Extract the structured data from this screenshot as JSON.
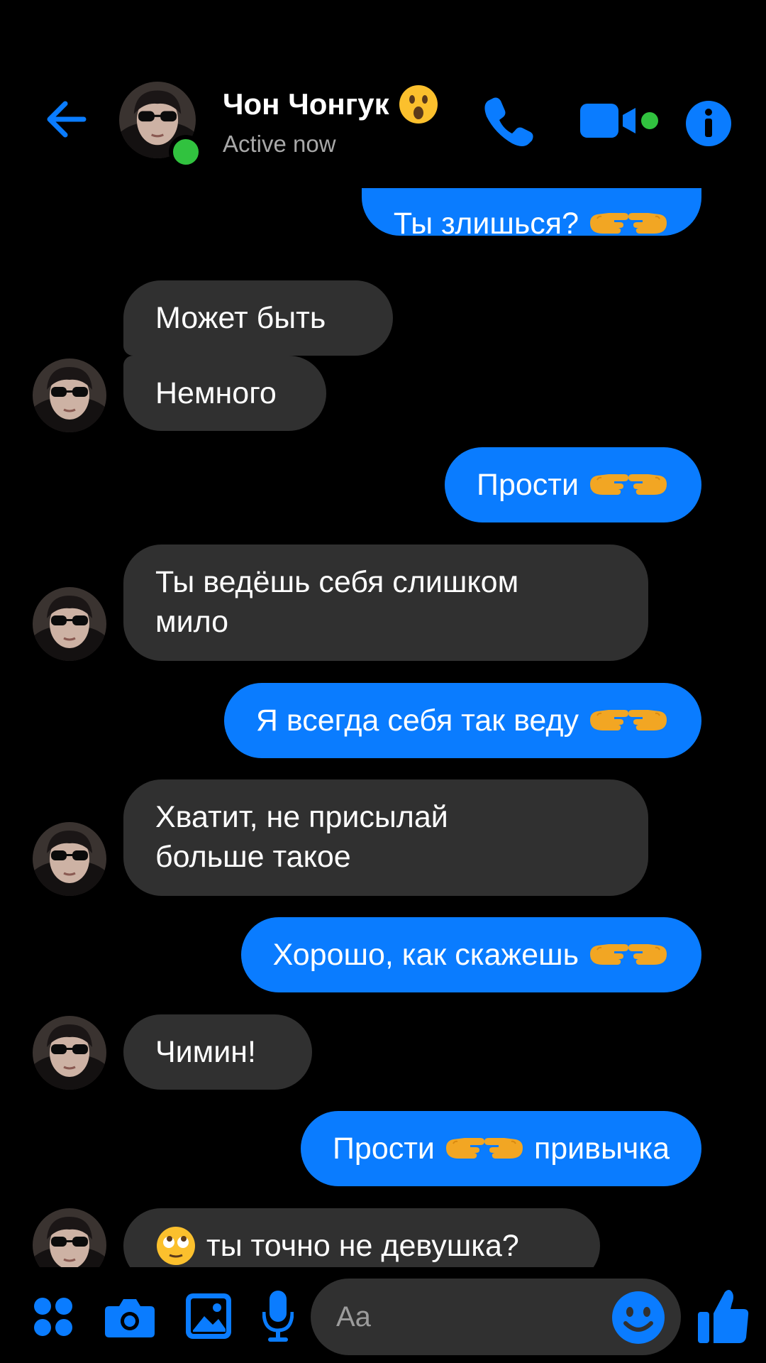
{
  "header": {
    "contact_name": "Чон Чонгук",
    "status": "Active now",
    "accent_color": "#0a7cff",
    "online_color": "#31c23f",
    "name_emoji_icon": "astonished-face-icon"
  },
  "messages": [
    {
      "direction": "outgoing",
      "text": "Ты злишься?",
      "emoji_icon": "pointing-fingers-icon"
    },
    {
      "direction": "incoming",
      "text": "Может быть"
    },
    {
      "direction": "incoming",
      "text": "Немного",
      "avatar": true
    },
    {
      "direction": "outgoing",
      "text": "Прости",
      "emoji_icon": "pointing-fingers-icon"
    },
    {
      "direction": "incoming",
      "text": "Ты ведёшь себя слишком мило",
      "avatar": true
    },
    {
      "direction": "outgoing",
      "text": "Я всегда себя так веду",
      "emoji_icon": "pointing-fingers-icon"
    },
    {
      "direction": "incoming",
      "text": "Хватит, не присылай больше такое",
      "avatar": true
    },
    {
      "direction": "outgoing",
      "text": "Хорошо, как скажешь",
      "emoji_icon": "pointing-fingers-icon"
    },
    {
      "direction": "incoming",
      "text": "Чимин!",
      "avatar": true
    },
    {
      "direction": "outgoing",
      "text_before": "Прости",
      "text_after": "привычка",
      "emoji_icon": "pointing-fingers-icon"
    },
    {
      "direction": "incoming",
      "text": "ты точно не девушка?",
      "emoji_icon": "rolling-eyes-face-icon",
      "avatar": true
    }
  ],
  "composer": {
    "placeholder": "Aa",
    "icons": [
      "four-dots-menu-icon",
      "camera-icon",
      "gallery-icon",
      "microphone-icon",
      "smiley-icon",
      "thumbs-up-icon"
    ]
  },
  "colors": {
    "outgoing_bubble": "#0a7cff",
    "incoming_bubble": "#303030",
    "background": "#000000"
  }
}
